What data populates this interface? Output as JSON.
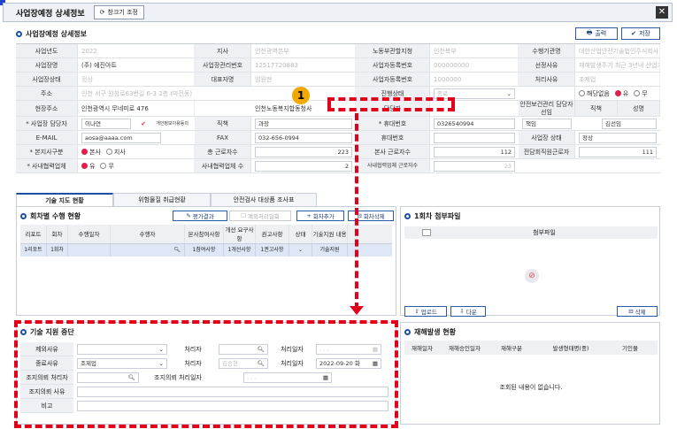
{
  "window": {
    "title": "사업장예정 상세정보",
    "btn_zoom": "창크기 조정",
    "close": "✕"
  },
  "section1": {
    "title": "사업장예정 상세정보",
    "print": "출력",
    "save": "저장"
  },
  "form": {
    "r1": {
      "l1": "사업년도",
      "v1": "2022",
      "l2": "지사",
      "v2": "인천광역본부",
      "l3": "노동부관할지청",
      "v3": "인천북부",
      "l4": "수행기관명",
      "v4": "대한산업안전기술법인주식회사"
    },
    "r2": {
      "l1": "사업장명",
      "v1": "(주) 에진아트",
      "l2": "사업장관리번호",
      "v2": "12517720883",
      "l3": "사업자등록번호",
      "v3": "000000000",
      "l4": "선정사유",
      "v4": "재해발생주기 최근 3년내 산업기계로 인한 사고"
    },
    "r3": {
      "l1": "사업장상태",
      "v1": "정상",
      "l2": "대표자명",
      "v2": "임원현",
      "l3": "사업자등록번호",
      "v3": "1000000",
      "l4": "처리사유",
      "v4": "조제업"
    },
    "r4": {
      "l1": "주소",
      "v1": "인천 서구 원창로63번길 6-3 2층 (마전동)",
      "l2": "진행상태",
      "v2": "종료",
      "l4": "",
      "radio_label1": "해당없음",
      "radio_label2": "유",
      "radio_label3": "무"
    },
    "r5": {
      "l1": "현장주소",
      "v1": "인천광역시 무네미로 476",
      "l2": "인천노동복지합동청사",
      "l3": "담당자",
      "l4": "안전보건관리 담당자 선임",
      "col1": "직책",
      "col2": "성명"
    },
    "r6": {
      "l1": "* 사업장 담당자",
      "v1": "이나연",
      "check": "개인정보이용동의",
      "l2": "직책",
      "v2": "과장",
      "l3": "* 휴대번호",
      "v3": "0326540994",
      "v4a": "책임",
      "v4b": "김선임"
    },
    "r7": {
      "l1": "E-MAIL",
      "v1": "aosa@aaaa.com",
      "l2": "FAX",
      "v2": "032-656-0994",
      "l3": "휴대번호",
      "l4": "사업장 상태",
      "v4": "정상"
    },
    "r8": {
      "l1": "* 본지사구분",
      "o1": "본사",
      "o2": "지사",
      "l2": "총 근로자수",
      "v2": "223",
      "l3": "본사 근로자수",
      "v3": "112",
      "l4": "전담회직원근로자",
      "v4": "111"
    },
    "r9": {
      "l1": "* 사내협력업체",
      "o1": "유",
      "o2": "무",
      "l2": "사내협력업체 수",
      "v2": "2",
      "l3": "사내협력업체 근로자수",
      "v3": "23"
    }
  },
  "tabs": [
    "기술 지도 현황",
    "위험물질 취급현황",
    "안전검사 대상품 조사표"
  ],
  "visits": {
    "title": "회차별 수행 현황",
    "btn_eval": "평가결과",
    "btn_pass": "계외처리일회",
    "btn_add": "회차추가",
    "btn_del": "회차삭제",
    "headers": [
      "리포트",
      "회차",
      "수행일자",
      "수행자",
      "본사참여사항",
      "개선 요구사항",
      "권고사항",
      "상태",
      "기술지원 내용"
    ],
    "row": [
      "1리포트",
      "1회차",
      "",
      "",
      "1참여사항",
      "1개선사항",
      "1권고사항",
      "",
      "기술지원"
    ]
  },
  "attach": {
    "title": "1회차 첨부파일",
    "header": "첨부파일",
    "upload": "업로드",
    "download": "다운",
    "delete": "삭제"
  },
  "support": {
    "title": "기술 지원 중단",
    "l1": "제외사유",
    "l2": "처리자",
    "l3": "처리일자",
    "v3": ". . .",
    "l4": "종료사유",
    "v4": "조제업",
    "l5": "처리자",
    "v5": "김승현",
    "l6": "처리일자",
    "v6": "2022-09-20 화",
    "l7": "조지의뢰 처리자",
    "l8": "조지의뢰 처리일자",
    "v8": ". . .",
    "l9": "조지의뢰 사유",
    "l10": "비고"
  },
  "accident": {
    "title": "재해발생 현황",
    "headers": [
      "재해일자",
      "재해승인일자",
      "재해구분",
      "발생형태명(중)",
      "기인물"
    ],
    "empty": "조회된 내용이 없습니다."
  },
  "callout": "1",
  "colors": {
    "accent": "#1d4fa3",
    "dash": "#e3001b",
    "callout": "#f2a900"
  }
}
